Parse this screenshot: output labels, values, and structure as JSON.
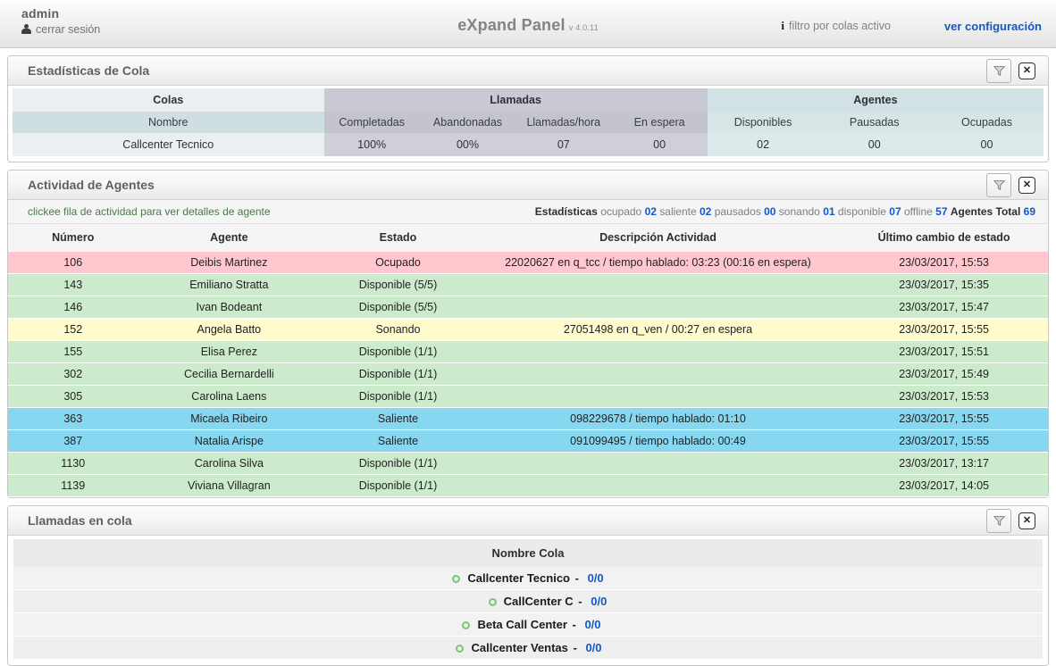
{
  "topbar": {
    "user": "admin",
    "logout": "cerrar sesión",
    "app_title": "eXpand Panel",
    "version": "v 4.0.11",
    "filter_note": "filtro por colas activo",
    "config_link": "ver configuración",
    "icons": {
      "user": "user-icon",
      "info": "info-icon"
    },
    "link_color": "#1258c8"
  },
  "panels": {
    "queue_stats": {
      "title": "Estadísticas de Cola",
      "filter_icon": "funnel-icon",
      "close_icon": "close-icon",
      "groups": [
        {
          "label": "Colas",
          "span": 1
        },
        {
          "label": "Llamadas",
          "span": 4
        },
        {
          "label": "Agentes",
          "span": 3
        }
      ],
      "columns": [
        "Nombre",
        "Completadas",
        "Abandonadas",
        "Llamadas/hora",
        "En espera",
        "Disponibles",
        "Pausadas",
        "Ocupadas"
      ],
      "rows": [
        [
          "Callcenter Tecnico",
          "100%",
          "00%",
          "07",
          "00",
          "02",
          "00",
          "00"
        ]
      ]
    },
    "agent_activity": {
      "title": "Actividad de Agentes",
      "filter_icon": "funnel-icon",
      "close_icon": "close-icon",
      "hint": "clickee fila de actividad para ver detalles de agente",
      "stats": {
        "label": "Estadísticas",
        "items": [
          {
            "name": "ocupado",
            "value": "02"
          },
          {
            "name": "saliente",
            "value": "02"
          },
          {
            "name": "pausados",
            "value": "00"
          },
          {
            "name": "sonando",
            "value": "01"
          },
          {
            "name": "disponible",
            "value": "07"
          },
          {
            "name": "offline",
            "value": "57"
          }
        ],
        "total_label": "Agentes Total",
        "total_value": "69"
      },
      "columns": [
        "Número",
        "Agente",
        "Estado",
        "Descripción Actividad",
        "Último cambio de estado"
      ],
      "rows": [
        {
          "numero": "106",
          "agente": "Deibis Martinez",
          "estado": "Ocupado",
          "descripcion": "22020627 en q_tcc / tiempo hablado: 03:23 (00:16 en espera)",
          "ultimo_cambio": "23/03/2017, 15:53",
          "state_class": "st-ocupado"
        },
        {
          "numero": "143",
          "agente": "Emiliano Stratta",
          "estado": "Disponible (5/5)",
          "descripcion": "",
          "ultimo_cambio": "23/03/2017, 15:35",
          "state_class": "st-disponible"
        },
        {
          "numero": "146",
          "agente": "Ivan Bodeant",
          "estado": "Disponible (5/5)",
          "descripcion": "",
          "ultimo_cambio": "23/03/2017, 15:47",
          "state_class": "st-disponible"
        },
        {
          "numero": "152",
          "agente": "Angela Batto",
          "estado": "Sonando",
          "descripcion": "27051498 en q_ven /  00:27 en espera",
          "ultimo_cambio": "23/03/2017, 15:55",
          "state_class": "st-sonando"
        },
        {
          "numero": "155",
          "agente": "Elisa Perez",
          "estado": "Disponible (1/1)",
          "descripcion": "",
          "ultimo_cambio": "23/03/2017, 15:51",
          "state_class": "st-disponible"
        },
        {
          "numero": "302",
          "agente": "Cecilia Bernardelli",
          "estado": "Disponible (1/1)",
          "descripcion": "",
          "ultimo_cambio": "23/03/2017, 15:49",
          "state_class": "st-disponible"
        },
        {
          "numero": "305",
          "agente": "Carolina Laens",
          "estado": "Disponible (1/1)",
          "descripcion": "",
          "ultimo_cambio": "23/03/2017, 15:53",
          "state_class": "st-disponible"
        },
        {
          "numero": "363",
          "agente": "Micaela Ribeiro",
          "estado": "Saliente",
          "descripcion": "098229678 / tiempo hablado: 01:10",
          "ultimo_cambio": "23/03/2017, 15:55",
          "state_class": "st-saliente"
        },
        {
          "numero": "387",
          "agente": "Natalia Arispe",
          "estado": "Saliente",
          "descripcion": "091099495 / tiempo hablado: 00:49",
          "ultimo_cambio": "23/03/2017, 15:55",
          "state_class": "st-saliente"
        },
        {
          "numero": "1130",
          "agente": "Carolina Silva",
          "estado": "Disponible (1/1)",
          "descripcion": "",
          "ultimo_cambio": "23/03/2017, 13:17",
          "state_class": "st-disponible"
        },
        {
          "numero": "1139",
          "agente": "Viviana Villagran",
          "estado": "Disponible (1/1)",
          "descripcion": "",
          "ultimo_cambio": "23/03/2017, 14:05",
          "state_class": "st-disponible"
        }
      ]
    },
    "calls_in_queue": {
      "title": "Llamadas en cola",
      "filter_icon": "funnel-icon",
      "close_icon": "close-icon",
      "column": "Nombre Cola",
      "rows": [
        {
          "bullet": "status-dot-icon",
          "name": "Callcenter Tecnico",
          "dash": "-",
          "count": "0/0",
          "indent": 0
        },
        {
          "bullet": "status-dot-icon",
          "name": "CallCenter C",
          "dash": "-",
          "count": "0/0",
          "indent": 44
        },
        {
          "bullet": "status-dot-icon",
          "name": "Beta Call Center",
          "dash": "-",
          "count": "0/0",
          "indent": 8
        },
        {
          "bullet": "status-dot-icon",
          "name": "Callcenter Ventas",
          "dash": "-",
          "count": "0/0",
          "indent": 2
        }
      ]
    }
  },
  "colors": {
    "accent_link": "#1258c8",
    "state_ocupado": "#ffc8ce",
    "state_disponible": "#ccebcc",
    "state_sonando": "#fffbcc",
    "state_saliente": "#87d7f0"
  }
}
